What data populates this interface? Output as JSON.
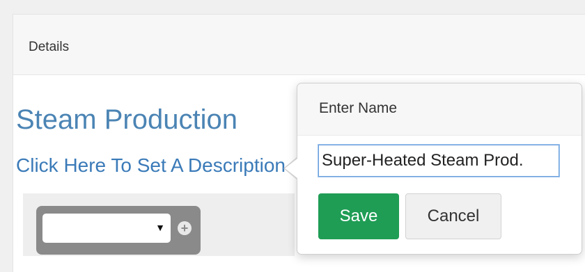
{
  "panel": {
    "title": "Details"
  },
  "content": {
    "heading": "Steam Production",
    "description_link": "Click Here To Set A Description"
  },
  "selector": {
    "selected_value": "",
    "caret_icon": "caret-down-icon",
    "add_icon": "plus-circle-icon"
  },
  "popover": {
    "title": "Enter Name",
    "input_value": "Super-Heated Steam Prod.",
    "save_label": "Save",
    "cancel_label": "Cancel"
  },
  "colors": {
    "heading": "#4b84b4",
    "link": "#3a7ab8",
    "save_button": "#1f9d55"
  }
}
